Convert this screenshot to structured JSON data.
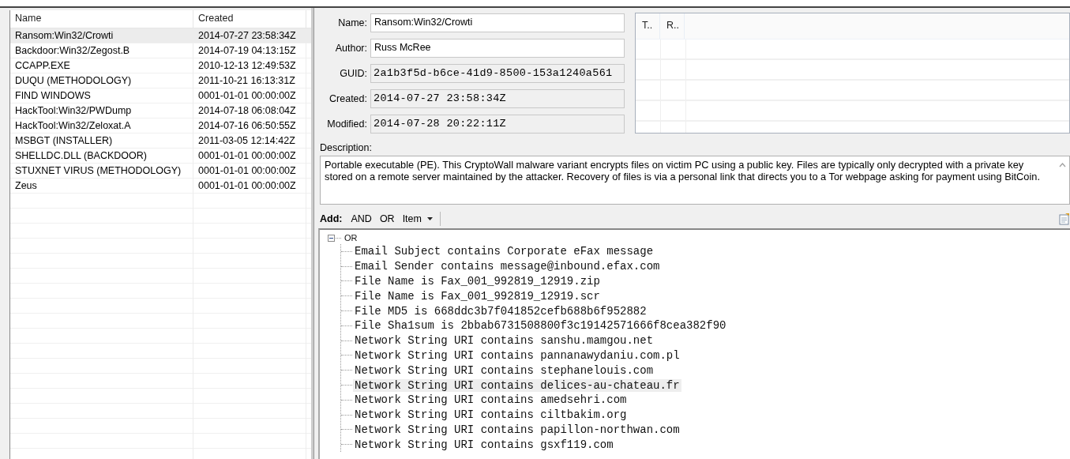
{
  "rules_list": {
    "columns": [
      "Name",
      "Created"
    ],
    "rows": [
      {
        "name": "Ransom:Win32/Crowti",
        "created": "2014-07-27 23:58:34Z",
        "selected": true
      },
      {
        "name": "Backdoor:Win32/Zegost.B",
        "created": "2014-07-19 04:13:15Z",
        "selected": false
      },
      {
        "name": "CCAPP.EXE",
        "created": "2010-12-13 12:49:53Z",
        "selected": false
      },
      {
        "name": "DUQU (METHODOLOGY)",
        "created": "2011-10-21 16:13:31Z",
        "selected": false
      },
      {
        "name": "FIND WINDOWS",
        "created": "0001-01-01 00:00:00Z",
        "selected": false
      },
      {
        "name": "HackTool:Win32/PWDump",
        "created": "2014-07-18 06:08:04Z",
        "selected": false
      },
      {
        "name": "HackTool:Win32/Zeloxat.A",
        "created": "2014-07-16 06:50:55Z",
        "selected": false
      },
      {
        "name": "MSBGT (INSTALLER)",
        "created": "2011-03-05 12:14:42Z",
        "selected": false
      },
      {
        "name": "SHELLDC.DLL (BACKDOOR)",
        "created": "0001-01-01 00:00:00Z",
        "selected": false
      },
      {
        "name": "STUXNET VIRUS (METHODOLOGY)",
        "created": "0001-01-01 00:00:00Z",
        "selected": false
      },
      {
        "name": "Zeus",
        "created": "0001-01-01 00:00:00Z",
        "selected": false
      }
    ]
  },
  "details": {
    "fields": [
      {
        "label": "Name:",
        "value": "Ransom:Win32/Crowti",
        "kind": "editable"
      },
      {
        "label": "Author:",
        "value": "Russ McRee",
        "kind": "editable"
      },
      {
        "label": "GUID:",
        "value": "2a1b3f5d-b6ce-41d9-8500-153a1240a561",
        "kind": "readonly"
      },
      {
        "label": "Created:",
        "value": "2014-07-27 23:58:34Z",
        "kind": "readonly"
      },
      {
        "label": "Modified:",
        "value": "2014-07-28 20:22:11Z",
        "kind": "readonly"
      }
    ]
  },
  "side_list": {
    "columns": [
      "T..",
      "R.."
    ]
  },
  "description": {
    "label": "Description:",
    "value": "Portable executable (PE). This CryptoWall malware variant encrypts files on victim PC using a public key. Files are typically only decrypted with a private key stored on a remote server maintained by the attacker. Recovery of files is via a personal link that directs you to a Tor webpage asking for payment using BitCoin."
  },
  "toolbar": {
    "label": "Add:",
    "items": [
      {
        "label": "AND",
        "kind": "button"
      },
      {
        "label": "OR",
        "kind": "button"
      },
      {
        "label": "Item",
        "kind": "dropdown"
      }
    ]
  },
  "tree": {
    "label": "OR",
    "expanded": true,
    "selected": false,
    "children": [
      {
        "label": "Email Subject contains Corporate eFax message",
        "selected": false
      },
      {
        "label": "Email Sender contains message@inbound.efax.com",
        "selected": false
      },
      {
        "label": "File Name is Fax_001_992819_12919.zip",
        "selected": false
      },
      {
        "label": "File Name is Fax_001_992819_12919.scr",
        "selected": false
      },
      {
        "label": "File MD5 is 668ddc3b7f041852cefb688b6f952882",
        "selected": false
      },
      {
        "label": "File Sha1sum is 2bbab6731508800f3c19142571666f8cea382f90",
        "selected": false
      },
      {
        "label": "Network String URI contains sanshu.mamgou.net",
        "selected": false
      },
      {
        "label": "Network String URI contains pannanawydaniu.com.pl",
        "selected": false
      },
      {
        "label": "Network String URI contains stephanelouis.com",
        "selected": false
      },
      {
        "label": "Network String URI contains delices-au-chateau.fr",
        "selected": true
      },
      {
        "label": "Network String URI contains amedsehri.com",
        "selected": false
      },
      {
        "label": "Network String URI contains ciltbakim.org",
        "selected": false
      },
      {
        "label": "Network String URI contains papillon-northwan.com",
        "selected": false
      },
      {
        "label": "Network String URI contains gsxf119.com",
        "selected": false
      }
    ]
  }
}
